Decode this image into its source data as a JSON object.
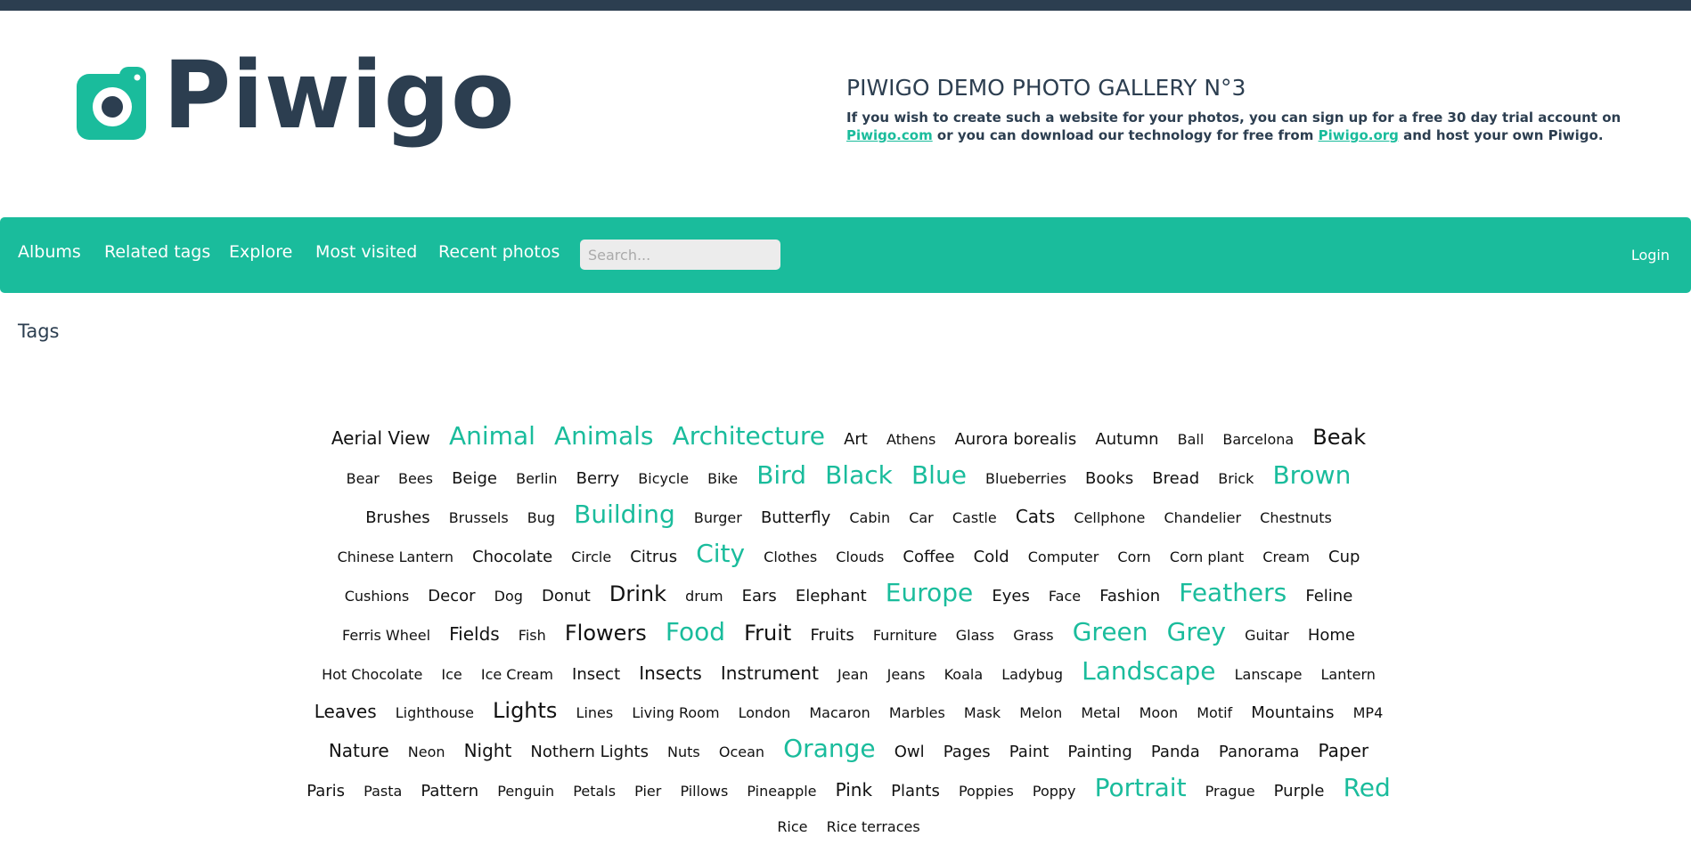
{
  "header": {
    "logo_text": "Piwigo",
    "title": "PIWIGO DEMO PHOTO GALLERY N°3",
    "desc_part1": "If you wish to create such a website for your photos, you can sign up for a free 30 day trial account on ",
    "link1": "Piwigo.com",
    "desc_part2": " or you can download our technology for free from ",
    "link2": "Piwigo.org",
    "desc_part3": " and host your own Piwigo."
  },
  "nav": {
    "items": [
      "Albums",
      "Related tags",
      "Explore",
      "Most visited",
      "Recent photos"
    ],
    "search_placeholder": "Search...",
    "login": "Login"
  },
  "page": {
    "title": "Tags"
  },
  "colors": {
    "accent": "#1abc9c",
    "dark": "#2c3e50"
  },
  "tags": [
    {
      "name": "Aerial View",
      "level": 3
    },
    {
      "name": "Animal",
      "level": 5
    },
    {
      "name": "Animals",
      "level": 5
    },
    {
      "name": "Architecture",
      "level": 5
    },
    {
      "name": "Art",
      "level": 2
    },
    {
      "name": "Athens",
      "level": 1
    },
    {
      "name": "Aurora borealis",
      "level": 2
    },
    {
      "name": "Autumn",
      "level": 2
    },
    {
      "name": "Ball",
      "level": 1
    },
    {
      "name": "Barcelona",
      "level": 1
    },
    {
      "name": "Beak",
      "level": 4
    },
    {
      "name": "Bear",
      "level": 1
    },
    {
      "name": "Bees",
      "level": 1
    },
    {
      "name": "Beige",
      "level": 2
    },
    {
      "name": "Berlin",
      "level": 1
    },
    {
      "name": "Berry",
      "level": 2
    },
    {
      "name": "Bicycle",
      "level": 1
    },
    {
      "name": "Bike",
      "level": 1
    },
    {
      "name": "Bird",
      "level": 5
    },
    {
      "name": "Black",
      "level": 5
    },
    {
      "name": "Blue",
      "level": 5
    },
    {
      "name": "Blueberries",
      "level": 1
    },
    {
      "name": "Books",
      "level": 2
    },
    {
      "name": "Bread",
      "level": 2
    },
    {
      "name": "Brick",
      "level": 1
    },
    {
      "name": "Brown",
      "level": 5
    },
    {
      "name": "Brushes",
      "level": 2
    },
    {
      "name": "Brussels",
      "level": 1
    },
    {
      "name": "Bug",
      "level": 1
    },
    {
      "name": "Building",
      "level": 5
    },
    {
      "name": "Burger",
      "level": 1
    },
    {
      "name": "Butterfly",
      "level": 2
    },
    {
      "name": "Cabin",
      "level": 1
    },
    {
      "name": "Car",
      "level": 1
    },
    {
      "name": "Castle",
      "level": 1
    },
    {
      "name": "Cats",
      "level": 3
    },
    {
      "name": "Cellphone",
      "level": 1
    },
    {
      "name": "Chandelier",
      "level": 1
    },
    {
      "name": "Chestnuts",
      "level": 1
    },
    {
      "name": "Chinese Lantern",
      "level": 1
    },
    {
      "name": "Chocolate",
      "level": 2
    },
    {
      "name": "Circle",
      "level": 1
    },
    {
      "name": "Citrus",
      "level": 2
    },
    {
      "name": "City",
      "level": 5
    },
    {
      "name": "Clothes",
      "level": 1
    },
    {
      "name": "Clouds",
      "level": 1
    },
    {
      "name": "Coffee",
      "level": 2
    },
    {
      "name": "Cold",
      "level": 2
    },
    {
      "name": "Computer",
      "level": 1
    },
    {
      "name": "Corn",
      "level": 1
    },
    {
      "name": "Corn plant",
      "level": 1
    },
    {
      "name": "Cream",
      "level": 1
    },
    {
      "name": "Cup",
      "level": 2
    },
    {
      "name": "Cushions",
      "level": 1
    },
    {
      "name": "Decor",
      "level": 2
    },
    {
      "name": "Dog",
      "level": 1
    },
    {
      "name": "Donut",
      "level": 2
    },
    {
      "name": "Drink",
      "level": 4
    },
    {
      "name": "drum",
      "level": 1
    },
    {
      "name": "Ears",
      "level": 2
    },
    {
      "name": "Elephant",
      "level": 2
    },
    {
      "name": "Europe",
      "level": 5
    },
    {
      "name": "Eyes",
      "level": 2
    },
    {
      "name": "Face",
      "level": 1
    },
    {
      "name": "Fashion",
      "level": 2
    },
    {
      "name": "Feathers",
      "level": 5
    },
    {
      "name": "Feline",
      "level": 2
    },
    {
      "name": "Ferris Wheel",
      "level": 1
    },
    {
      "name": "Fields",
      "level": 3
    },
    {
      "name": "Fish",
      "level": 1
    },
    {
      "name": "Flowers",
      "level": 4
    },
    {
      "name": "Food",
      "level": 5
    },
    {
      "name": "Fruit",
      "level": 4
    },
    {
      "name": "Fruits",
      "level": 2
    },
    {
      "name": "Furniture",
      "level": 1
    },
    {
      "name": "Glass",
      "level": 1
    },
    {
      "name": "Grass",
      "level": 1
    },
    {
      "name": "Green",
      "level": 5
    },
    {
      "name": "Grey",
      "level": 5
    },
    {
      "name": "Guitar",
      "level": 1
    },
    {
      "name": "Home",
      "level": 2
    },
    {
      "name": "Hot Chocolate",
      "level": 1
    },
    {
      "name": "Ice",
      "level": 1
    },
    {
      "name": "Ice Cream",
      "level": 1
    },
    {
      "name": "Insect",
      "level": 2
    },
    {
      "name": "Insects",
      "level": 3
    },
    {
      "name": "Instrument",
      "level": 3
    },
    {
      "name": "Jean",
      "level": 1
    },
    {
      "name": "Jeans",
      "level": 1
    },
    {
      "name": "Koala",
      "level": 1
    },
    {
      "name": "Ladybug",
      "level": 1
    },
    {
      "name": "Landscape",
      "level": 5
    },
    {
      "name": "Lanscape",
      "level": 1
    },
    {
      "name": "Lantern",
      "level": 1
    },
    {
      "name": "Leaves",
      "level": 3
    },
    {
      "name": "Lighthouse",
      "level": 1
    },
    {
      "name": "Lights",
      "level": 4
    },
    {
      "name": "Lines",
      "level": 1
    },
    {
      "name": "Living Room",
      "level": 1
    },
    {
      "name": "London",
      "level": 1
    },
    {
      "name": "Macaron",
      "level": 1
    },
    {
      "name": "Marbles",
      "level": 1
    },
    {
      "name": "Mask",
      "level": 1
    },
    {
      "name": "Melon",
      "level": 1
    },
    {
      "name": "Metal",
      "level": 1
    },
    {
      "name": "Moon",
      "level": 1
    },
    {
      "name": "Motif",
      "level": 1
    },
    {
      "name": "Mountains",
      "level": 2
    },
    {
      "name": "MP4",
      "level": 1
    },
    {
      "name": "Nature",
      "level": 3
    },
    {
      "name": "Neon",
      "level": 1
    },
    {
      "name": "Night",
      "level": 3
    },
    {
      "name": "Nothern Lights",
      "level": 2
    },
    {
      "name": "Nuts",
      "level": 1
    },
    {
      "name": "Ocean",
      "level": 1
    },
    {
      "name": "Orange",
      "level": 5
    },
    {
      "name": "Owl",
      "level": 2
    },
    {
      "name": "Pages",
      "level": 2
    },
    {
      "name": "Paint",
      "level": 2
    },
    {
      "name": "Painting",
      "level": 2
    },
    {
      "name": "Panda",
      "level": 2
    },
    {
      "name": "Panorama",
      "level": 2
    },
    {
      "name": "Paper",
      "level": 3
    },
    {
      "name": "Paris",
      "level": 2
    },
    {
      "name": "Pasta",
      "level": 1
    },
    {
      "name": "Pattern",
      "level": 2
    },
    {
      "name": "Penguin",
      "level": 1
    },
    {
      "name": "Petals",
      "level": 1
    },
    {
      "name": "Pier",
      "level": 1
    },
    {
      "name": "Pillows",
      "level": 1
    },
    {
      "name": "Pineapple",
      "level": 1
    },
    {
      "name": "Pink",
      "level": 3
    },
    {
      "name": "Plants",
      "level": 2
    },
    {
      "name": "Poppies",
      "level": 1
    },
    {
      "name": "Poppy",
      "level": 1
    },
    {
      "name": "Portrait",
      "level": 5
    },
    {
      "name": "Prague",
      "level": 1
    },
    {
      "name": "Purple",
      "level": 2
    },
    {
      "name": "Red",
      "level": 5
    },
    {
      "name": "Rice",
      "level": 1
    },
    {
      "name": "Rice terraces",
      "level": 1
    }
  ]
}
